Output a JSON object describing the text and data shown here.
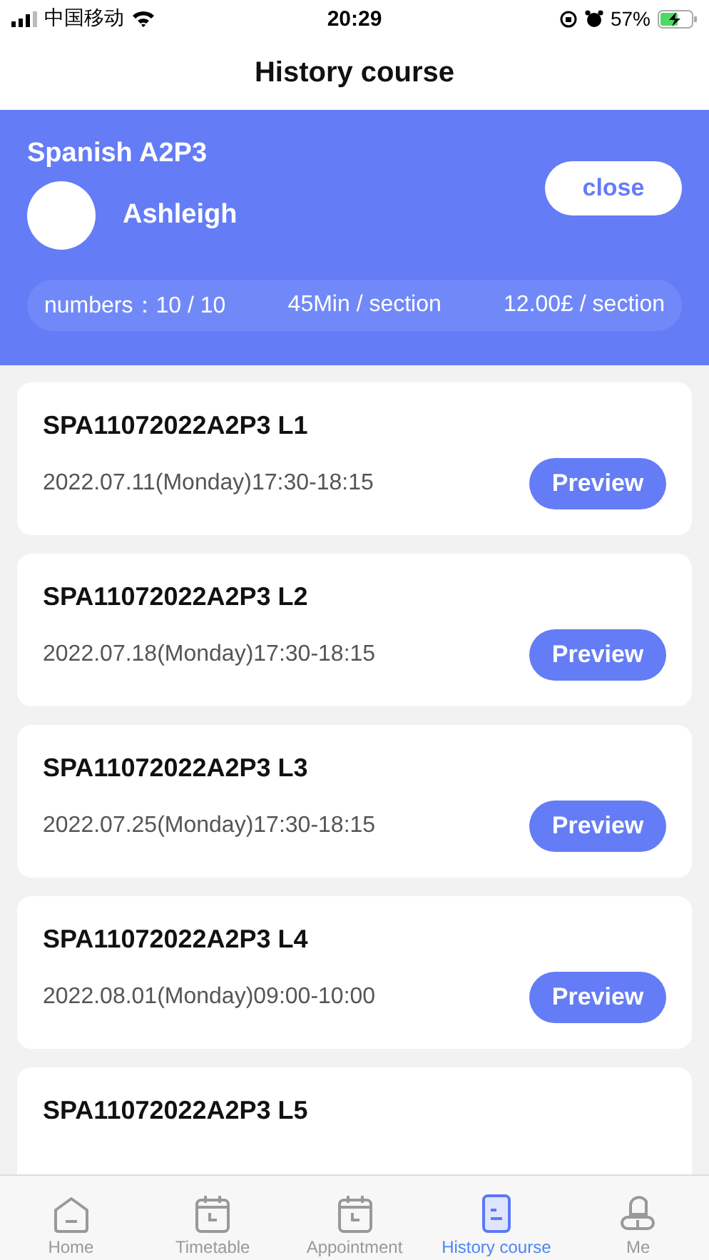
{
  "status_bar": {
    "carrier": "中国移动",
    "time": "20:29",
    "battery": "57%"
  },
  "nav": {
    "title": "History course"
  },
  "course": {
    "title": "Spanish A2P3",
    "teacher": "Ashleigh",
    "button": "close",
    "stats": [
      "numbers：10 / 10",
      "45Min / section",
      "12.00£ / section"
    ]
  },
  "lessons": [
    {
      "code": "SPA11072022A2P3 L1",
      "time": "2022.07.11(Monday)17:30-18:15",
      "button": "Preview"
    },
    {
      "code": "SPA11072022A2P3 L2",
      "time": "2022.07.18(Monday)17:30-18:15",
      "button": "Preview"
    },
    {
      "code": "SPA11072022A2P3 L3",
      "time": "2022.07.25(Monday)17:30-18:15",
      "button": "Preview"
    },
    {
      "code": "SPA11072022A2P3 L4",
      "time": "2022.08.01(Monday)09:00-10:00",
      "button": "Preview"
    },
    {
      "code": "SPA11072022A2P3 L5"
    }
  ],
  "tabs": [
    {
      "label": "Home",
      "kind": "home",
      "selected": false
    },
    {
      "label": "Timetable",
      "kind": "calendar",
      "selected": false
    },
    {
      "label": "Appointment",
      "kind": "calendar",
      "selected": false
    },
    {
      "label": "History course",
      "kind": "document",
      "selected": true
    },
    {
      "label": "Me",
      "kind": "person",
      "selected": false
    }
  ]
}
